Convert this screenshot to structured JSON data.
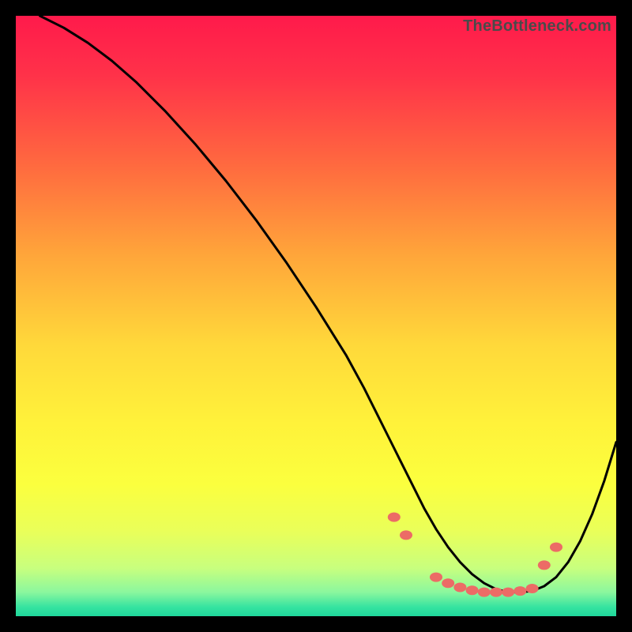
{
  "watermark": {
    "text": "TheBottleneck.com",
    "color": "#4a4a4a"
  },
  "colors": {
    "curve": "#000000",
    "marker_fill": "#ec6b66",
    "gradient_stops": [
      {
        "offset": 0.0,
        "color": "#ff1a4b"
      },
      {
        "offset": 0.1,
        "color": "#ff3249"
      },
      {
        "offset": 0.25,
        "color": "#ff6a3f"
      },
      {
        "offset": 0.4,
        "color": "#ffa63a"
      },
      {
        "offset": 0.55,
        "color": "#ffd93a"
      },
      {
        "offset": 0.68,
        "color": "#fff23a"
      },
      {
        "offset": 0.78,
        "color": "#fbff3e"
      },
      {
        "offset": 0.86,
        "color": "#e9ff5a"
      },
      {
        "offset": 0.92,
        "color": "#c8ff7e"
      },
      {
        "offset": 0.96,
        "color": "#8bf79e"
      },
      {
        "offset": 0.985,
        "color": "#35e3a0"
      },
      {
        "offset": 1.0,
        "color": "#1fd79b"
      }
    ]
  },
  "chart_data": {
    "type": "line",
    "title": "",
    "xlabel": "",
    "ylabel": "",
    "xlim": [
      0,
      100
    ],
    "ylim": [
      0,
      100
    ],
    "note": "Axes unlabeled; values are pixel-estimated on a 0–100 normalized scale. The curve descends steeply from the top-left, flattens near the bottom around x≈68–88, then rises toward the right edge. Red markers sit on the flat/low region.",
    "series": [
      {
        "name": "curve",
        "x": [
          4,
          8,
          12,
          16,
          20,
          25,
          30,
          35,
          40,
          45,
          50,
          55,
          58,
          60,
          62,
          64,
          66,
          68,
          70,
          72,
          74,
          76,
          78,
          80,
          82,
          84,
          86,
          88,
          90,
          92,
          94,
          96,
          98,
          100
        ],
        "y": [
          100,
          98,
          95.5,
          92.5,
          89,
          84,
          78.5,
          72.5,
          66,
          59,
          51.5,
          43.5,
          38,
          34,
          30,
          26,
          22,
          18,
          14.5,
          11.5,
          9,
          7,
          5.5,
          4.5,
          4,
          4,
          4.2,
          5,
          6.5,
          9,
          12.5,
          17,
          22.5,
          29
        ]
      }
    ],
    "markers": {
      "name": "highlighted-points",
      "points": [
        {
          "x": 63,
          "y": 16.5
        },
        {
          "x": 65,
          "y": 13.5
        },
        {
          "x": 70,
          "y": 6.5
        },
        {
          "x": 72,
          "y": 5.5
        },
        {
          "x": 74,
          "y": 4.8
        },
        {
          "x": 76,
          "y": 4.3
        },
        {
          "x": 78,
          "y": 4.0
        },
        {
          "x": 80,
          "y": 4.0
        },
        {
          "x": 82,
          "y": 4.0
        },
        {
          "x": 84,
          "y": 4.2
        },
        {
          "x": 86,
          "y": 4.6
        },
        {
          "x": 88,
          "y": 8.5
        },
        {
          "x": 90,
          "y": 11.5
        }
      ]
    }
  }
}
